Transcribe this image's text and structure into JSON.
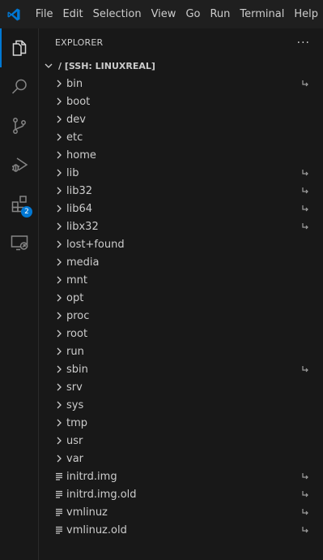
{
  "menu": [
    "File",
    "Edit",
    "Selection",
    "View",
    "Go",
    "Run",
    "Terminal",
    "Help"
  ],
  "activity": {
    "extensions_badge": "2"
  },
  "sidebar": {
    "title": "EXPLORER",
    "more": "···",
    "section_title": "/ [SSH: LINUXREAL]",
    "items": [
      {
        "label": "bin",
        "type": "folder",
        "symlink": true
      },
      {
        "label": "boot",
        "type": "folder",
        "symlink": false
      },
      {
        "label": "dev",
        "type": "folder",
        "symlink": false
      },
      {
        "label": "etc",
        "type": "folder",
        "symlink": false
      },
      {
        "label": "home",
        "type": "folder",
        "symlink": false
      },
      {
        "label": "lib",
        "type": "folder",
        "symlink": true
      },
      {
        "label": "lib32",
        "type": "folder",
        "symlink": true
      },
      {
        "label": "lib64",
        "type": "folder",
        "symlink": true
      },
      {
        "label": "libx32",
        "type": "folder",
        "symlink": true
      },
      {
        "label": "lost+found",
        "type": "folder",
        "symlink": false
      },
      {
        "label": "media",
        "type": "folder",
        "symlink": false
      },
      {
        "label": "mnt",
        "type": "folder",
        "symlink": false
      },
      {
        "label": "opt",
        "type": "folder",
        "symlink": false
      },
      {
        "label": "proc",
        "type": "folder",
        "symlink": false
      },
      {
        "label": "root",
        "type": "folder",
        "symlink": false
      },
      {
        "label": "run",
        "type": "folder",
        "symlink": false
      },
      {
        "label": "sbin",
        "type": "folder",
        "symlink": true
      },
      {
        "label": "srv",
        "type": "folder",
        "symlink": false
      },
      {
        "label": "sys",
        "type": "folder",
        "symlink": false
      },
      {
        "label": "tmp",
        "type": "folder",
        "symlink": false
      },
      {
        "label": "usr",
        "type": "folder",
        "symlink": false
      },
      {
        "label": "var",
        "type": "folder",
        "symlink": false
      },
      {
        "label": "initrd.img",
        "type": "file",
        "symlink": true
      },
      {
        "label": "initrd.img.old",
        "type": "file",
        "symlink": true
      },
      {
        "label": "vmlinuz",
        "type": "file",
        "symlink": true
      },
      {
        "label": "vmlinuz.old",
        "type": "file",
        "symlink": true
      }
    ]
  },
  "colors": {
    "accent": "#0078d4",
    "background": "#181818",
    "text": "#cccccc"
  }
}
